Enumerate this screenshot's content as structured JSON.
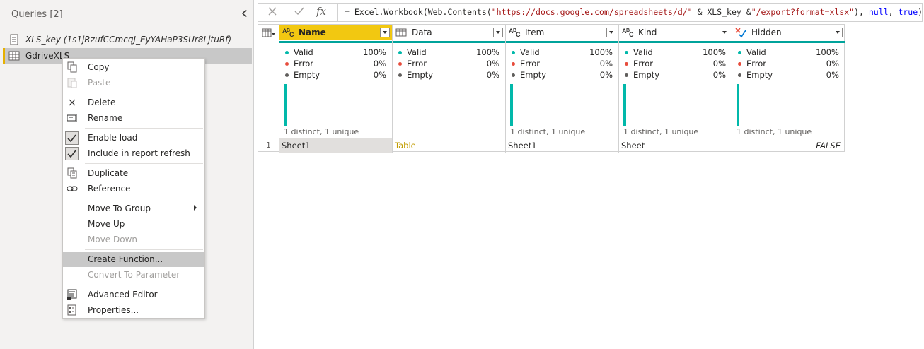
{
  "queries_pane": {
    "title": "Queries [2]",
    "collapse_icon": "chevron-left-icon",
    "items": [
      {
        "label": "XLS_key (1s1jRzufCCmcqJ_EyYAHaP3SUr8LjtuRf)",
        "icon": "parameter-icon"
      },
      {
        "label": "GdriveXLS",
        "icon": "table-icon"
      }
    ]
  },
  "context_menu": {
    "items": [
      {
        "label": "Copy",
        "icon": "copy-icon"
      },
      {
        "label": "Paste",
        "icon": "paste-icon"
      },
      {
        "label": "Delete",
        "icon": "delete-icon"
      },
      {
        "label": "Rename",
        "icon": "rename-icon"
      },
      {
        "label": "Enable load",
        "icon": "checkbox-checked-icon"
      },
      {
        "label": "Include in report refresh",
        "icon": "checkbox-checked-icon"
      },
      {
        "label": "Duplicate",
        "icon": "duplicate-icon"
      },
      {
        "label": "Reference",
        "icon": "reference-icon"
      },
      {
        "label": "Move To Group",
        "icon": "submenu-arrow-icon"
      },
      {
        "label": "Move Up"
      },
      {
        "label": "Move Down"
      },
      {
        "label": "Create Function..."
      },
      {
        "label": "Convert To Parameter"
      },
      {
        "label": "Advanced Editor",
        "icon": "advanced-editor-icon"
      },
      {
        "label": "Properties...",
        "icon": "properties-icon"
      }
    ]
  },
  "formula_bar": {
    "cancel_icon": "close-icon",
    "commit_icon": "checkmark-icon",
    "fx_label": "fx",
    "formula_prefix": "= Excel.Workbook(Web.Contents(",
    "formula_str1": "\"https://docs.google.com/spreadsheets/d/\"",
    "formula_mid": " & XLS_key &",
    "formula_str2": "\"/export?format=xlsx\"",
    "formula_sep1": "), ",
    "formula_kw1": "null",
    "formula_sep2": ", ",
    "formula_kw2": "true",
    "formula_end": ")"
  },
  "grid": {
    "columns": [
      {
        "name": "Name",
        "type_icon": "text-type-icon",
        "valid": "Valid",
        "valid_pct": "100%",
        "error": "Error",
        "error_pct": "0%",
        "empty": "Empty",
        "empty_pct": "0%",
        "distinct": "1 distinct, 1 unique",
        "cell": "Sheet1"
      },
      {
        "name": "Data",
        "type_icon": "table-type-icon",
        "valid": "Valid",
        "valid_pct": "100%",
        "error": "Error",
        "error_pct": "0%",
        "empty": "Empty",
        "empty_pct": "0%",
        "distinct": "",
        "cell": "Table"
      },
      {
        "name": "Item",
        "type_icon": "text-type-icon",
        "valid": "Valid",
        "valid_pct": "100%",
        "error": "Error",
        "error_pct": "0%",
        "empty": "Empty",
        "empty_pct": "0%",
        "distinct": "1 distinct, 1 unique",
        "cell": "Sheet1"
      },
      {
        "name": "Kind",
        "type_icon": "text-type-icon",
        "valid": "Valid",
        "valid_pct": "100%",
        "error": "Error",
        "error_pct": "0%",
        "empty": "Empty",
        "empty_pct": "0%",
        "distinct": "1 distinct, 1 unique",
        "cell": "Sheet"
      },
      {
        "name": "Hidden",
        "type_icon": "logical-type-icon",
        "valid": "Valid",
        "valid_pct": "100%",
        "error": "Error",
        "error_pct": "0%",
        "empty": "Empty",
        "empty_pct": "0%",
        "distinct": "1 distinct, 1 unique",
        "cell": "FALSE"
      }
    ],
    "row_number": "1"
  },
  "colors": {
    "accent_yellow": "#f2c811",
    "teal": "#00a39b",
    "valid_dot": "#01b8aa",
    "error_dot": "#e74c3c",
    "empty_dot": "#605e5c"
  }
}
